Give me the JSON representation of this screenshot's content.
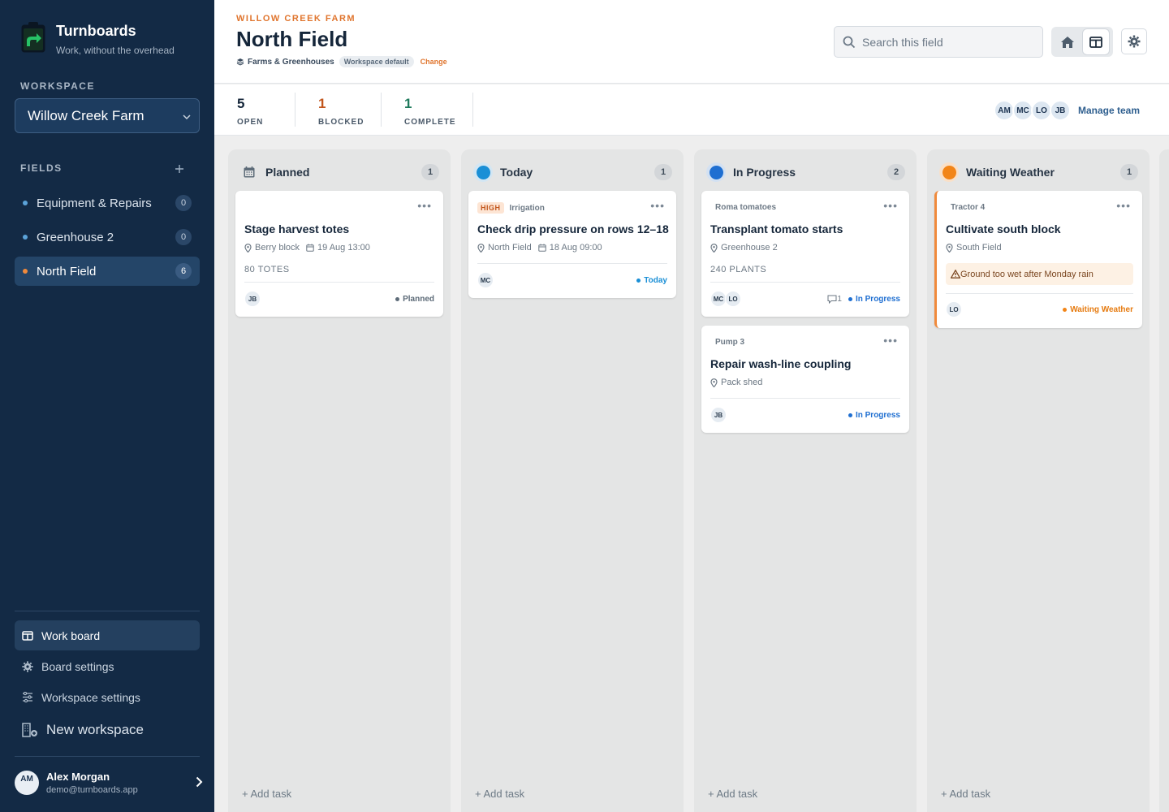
{
  "app": {
    "name": "Turnboards",
    "tagline": "Work, without the overhead"
  },
  "sidebar": {
    "workspace_label": "WORKSPACE",
    "workspace_value": "Willow Creek Farm",
    "fields_label": "FIELDS",
    "fields": [
      {
        "label": "Equipment & Repairs",
        "count": "0"
      },
      {
        "label": "Greenhouse 2",
        "count": "0"
      },
      {
        "label": "North Field",
        "count": "6"
      }
    ],
    "nav": [
      {
        "label": "Work board"
      },
      {
        "label": "Board settings"
      },
      {
        "label": "Workspace settings"
      },
      {
        "label": "New workspace"
      }
    ],
    "user": {
      "initials": "AM",
      "name": "Alex Morgan",
      "email": "demo@turnboards.app"
    }
  },
  "header": {
    "eyebrow": "WILLOW CREEK FARM",
    "title": "North Field",
    "group": "Farms & Greenhouses",
    "pill": "Workspace default",
    "change": "Change",
    "search_placeholder": "Search this field"
  },
  "stats": [
    {
      "value": "5",
      "label": "OPEN",
      "color": "#15263a"
    },
    {
      "value": "1",
      "label": "BLOCKED",
      "color": "#c2561c"
    },
    {
      "value": "1",
      "label": "COMPLETE",
      "color": "#1f7a5c"
    }
  ],
  "team": {
    "members": [
      "AM",
      "MC",
      "LO",
      "JB"
    ],
    "manage": "Manage team"
  },
  "columns": [
    {
      "title": "Planned",
      "count": "1",
      "add": "+ Add task",
      "cards": [
        {
          "title": "Stage harvest totes",
          "location": "Berry block",
          "date": "19 Aug 13:00",
          "qty": "80 TOTES",
          "assignees": [
            "JB"
          ],
          "status": "Planned"
        }
      ]
    },
    {
      "title": "Today",
      "count": "1",
      "add": "+ Add task",
      "cards": [
        {
          "priority": "HIGH",
          "tag": "Irrigation",
          "title": "Check drip pressure on rows 12–18",
          "location": "North Field",
          "date": "18 Aug 09:00",
          "assignees": [
            "MC"
          ],
          "status": "Today"
        }
      ]
    },
    {
      "title": "In Progress",
      "count": "2",
      "add": "+ Add task",
      "cards": [
        {
          "tag": "Roma tomatoes",
          "title": "Transplant tomato starts",
          "location": "Greenhouse 2",
          "qty": "240 PLANTS",
          "assignees": [
            "MC",
            "LO"
          ],
          "comments": "1",
          "status": "In Progress"
        },
        {
          "tag": "Pump 3",
          "title": "Repair wash-line coupling",
          "location": "Pack shed",
          "assignees": [
            "JB"
          ],
          "status": "In Progress"
        }
      ]
    },
    {
      "title": "Waiting Weather",
      "count": "1",
      "add": "+ Add task",
      "cards": [
        {
          "tag": "Tractor 4",
          "title": "Cultivate south block",
          "location": "South Field",
          "alert": "Ground too wet after Monday rain",
          "assignees": [
            "LO"
          ],
          "status": "Waiting Weather"
        }
      ]
    }
  ],
  "colors": {
    "sidebar": "#132a45",
    "accent": "#e0752e",
    "today": "#1a8fd6",
    "in_progress": "#1f6fd1",
    "waiting": "#f28518",
    "planned": "#5d6b78"
  }
}
